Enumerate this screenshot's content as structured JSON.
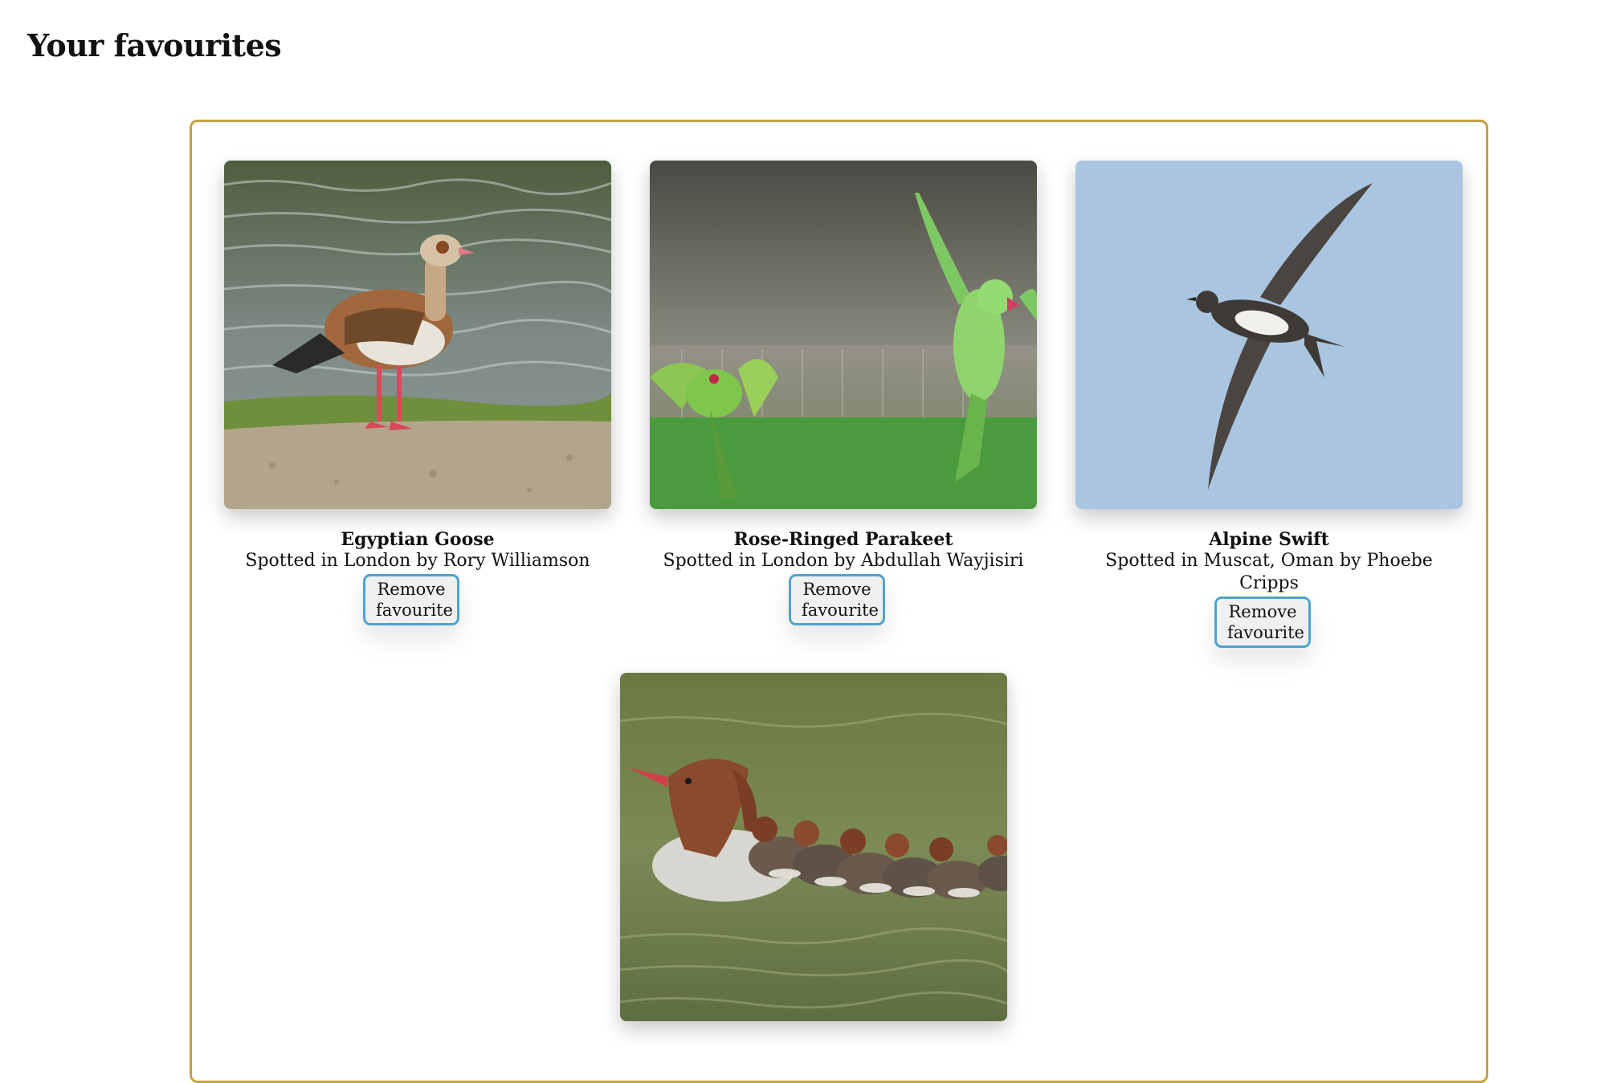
{
  "page": {
    "title": "Your favourites"
  },
  "favourites": [
    {
      "name": "Egyptian Goose",
      "spotted": "Spotted in London by Rory Williamson",
      "button": "Remove favourite",
      "image": "egyptian-goose-photo"
    },
    {
      "name": "Rose-Ringed Parakeet",
      "spotted": "Spotted in London by Abdullah Wayjisiri",
      "button": "Remove favourite",
      "image": "rose-ringed-parakeet-photo"
    },
    {
      "name": "Alpine Swift",
      "spotted": "Spotted in Muscat, Oman by Phoebe Cripps",
      "button": "Remove favourite",
      "image": "alpine-swift-photo"
    },
    {
      "name": "",
      "spotted": "",
      "button": "",
      "image": "merganser-with-ducklings-photo"
    }
  ],
  "colors": {
    "panel_border": "#c8a03c",
    "button_border": "#4ea3cf"
  }
}
